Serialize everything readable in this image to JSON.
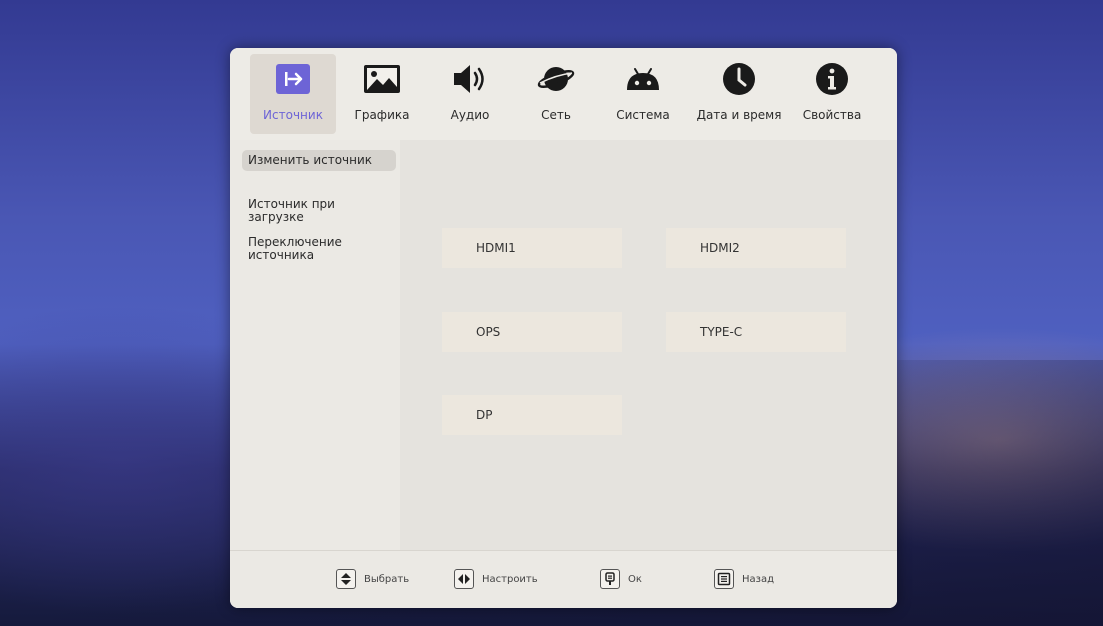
{
  "tabs": [
    {
      "label": "Источник",
      "icon": "input-source-icon"
    },
    {
      "label": "Графика",
      "icon": "picture-icon"
    },
    {
      "label": "Аудио",
      "icon": "speaker-icon"
    },
    {
      "label": "Сеть",
      "icon": "planet-icon"
    },
    {
      "label": "Система",
      "icon": "android-icon"
    },
    {
      "label": "Дата и время",
      "icon": "clock-icon"
    },
    {
      "label": "Свойства",
      "icon": "info-icon"
    }
  ],
  "active_tab": "Источник",
  "accent_color": "#6d64d6",
  "sidebar": {
    "items": [
      {
        "label": "Изменить источник",
        "selected": true
      },
      {
        "label": "Источник при загрузке",
        "selected": false
      },
      {
        "label": "Переключение источника",
        "selected": false
      }
    ]
  },
  "sources": [
    "HDMI1",
    "HDMI2",
    "OPS",
    "TYPE-C",
    "DP"
  ],
  "footer": {
    "select": {
      "label": "Выбрать",
      "icon": "up-down-key-icon"
    },
    "adjust": {
      "label": "Настроить",
      "icon": "left-right-key-icon"
    },
    "ok": {
      "label": "Ок",
      "icon": "ok-key-icon"
    },
    "back": {
      "label": "Назад",
      "icon": "menu-back-key-icon"
    }
  }
}
